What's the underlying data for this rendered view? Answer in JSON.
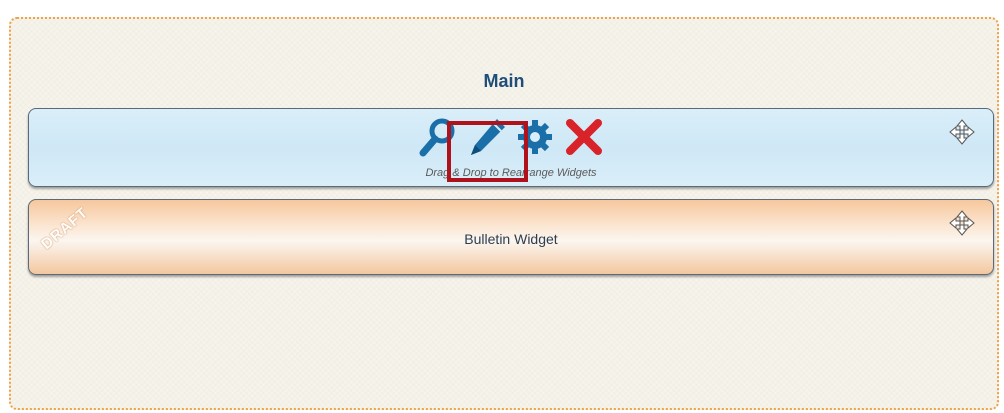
{
  "zone": {
    "title": "Main",
    "border_color": "#f0a24a"
  },
  "edit_widget": {
    "tools": [
      {
        "name": "preview",
        "icon": "magnifier-icon"
      },
      {
        "name": "edit",
        "icon": "pencil-icon",
        "highlighted": true
      },
      {
        "name": "settings",
        "icon": "gear-icon"
      },
      {
        "name": "delete",
        "icon": "close-x-icon"
      }
    ],
    "drag_hint": "Drag & Drop to Rearrange Widgets",
    "move_icon": "move-arrows-icon",
    "background": "#d9eef9"
  },
  "bulletin_widget": {
    "label": "Bulletin Widget",
    "badge": "DRAFT",
    "move_icon": "move-arrows-icon"
  },
  "colors": {
    "tool_blue": "#1a6fa8",
    "delete_red": "#d9232a",
    "highlight": "#b0121b"
  }
}
